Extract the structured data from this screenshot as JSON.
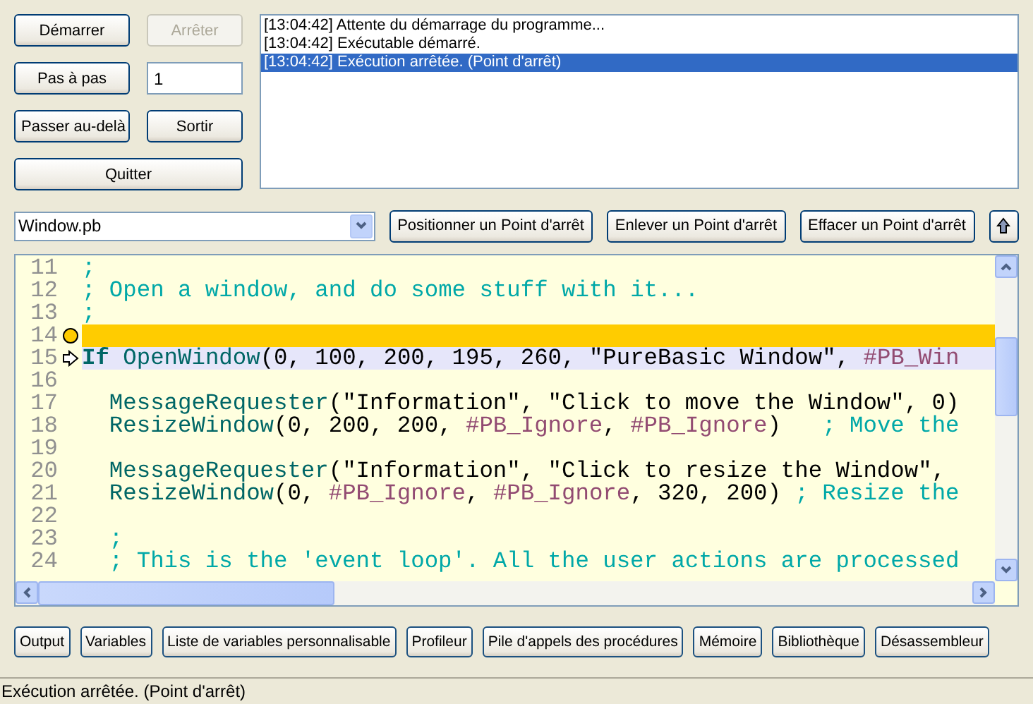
{
  "control_buttons": [
    {
      "label": "Démarrer",
      "disabled": false
    },
    {
      "label": "Arrêter",
      "disabled": true
    },
    {
      "label": "Pas à pas",
      "disabled": false
    },
    {
      "label": "Passer au-delà",
      "disabled": false
    },
    {
      "label": "Sortir",
      "disabled": false
    },
    {
      "label": "Quitter",
      "disabled": false
    }
  ],
  "step_count": {
    "value": "1"
  },
  "log": [
    {
      "text": "[13:04:42] Attente du démarrage du programme...",
      "selected": false
    },
    {
      "text": "[13:04:42] Exécutable démarré.",
      "selected": false
    },
    {
      "text": "[13:04:42] Exécution arrêtée. (Point d'arrêt)",
      "selected": true
    }
  ],
  "file_select": {
    "value": "Window.pb"
  },
  "breakpoint_buttons": [
    "Positionner un Point d'arrêt",
    "Enlever un Point d'arrêt",
    "Effacer un Point d'arrêt"
  ],
  "editor": {
    "lines": [
      {
        "number": "11",
        "tokens": [
          {
            "kind": "comment",
            "text": ";"
          }
        ]
      },
      {
        "number": "12",
        "tokens": [
          {
            "kind": "comment",
            "text": "; Open a window, and do some stuff with it..."
          }
        ]
      },
      {
        "number": "13",
        "tokens": [
          {
            "kind": "comment",
            "text": ";"
          }
        ]
      },
      {
        "number": "14",
        "breakpoint": true
      },
      {
        "number": "15",
        "current": true,
        "tokens": [
          {
            "kind": "keyword",
            "text": "If "
          },
          {
            "kind": "function",
            "text": "OpenWindow"
          },
          {
            "kind": "plain",
            "text": "(0, 100, 200, 195, 260, \"PureBasic Window\", "
          },
          {
            "kind": "constant",
            "text": "#PB_Win"
          }
        ]
      },
      {
        "number": "16"
      },
      {
        "number": "17",
        "indented": true,
        "tokens": [
          {
            "kind": "function",
            "text": "MessageRequester"
          },
          {
            "kind": "plain",
            "text": "(\"Information\", \"Click to move the Window\", 0)"
          }
        ]
      },
      {
        "number": "18",
        "indented": true,
        "tokens": [
          {
            "kind": "function",
            "text": "ResizeWindow"
          },
          {
            "kind": "plain",
            "text": "(0, 200, 200, "
          },
          {
            "kind": "constant",
            "text": "#PB_Ignore"
          },
          {
            "kind": "plain",
            "text": ", "
          },
          {
            "kind": "constant",
            "text": "#PB_Ignore"
          },
          {
            "kind": "plain",
            "text": ")   "
          },
          {
            "kind": "comment",
            "text": "; Move the"
          }
        ]
      },
      {
        "number": "19"
      },
      {
        "number": "20",
        "indented": true,
        "tokens": [
          {
            "kind": "function",
            "text": "MessageRequester"
          },
          {
            "kind": "plain",
            "text": "(\"Information\", \"Click to resize the Window\","
          }
        ]
      },
      {
        "number": "21",
        "indented": true,
        "tokens": [
          {
            "kind": "function",
            "text": "ResizeWindow"
          },
          {
            "kind": "plain",
            "text": "(0, "
          },
          {
            "kind": "constant",
            "text": "#PB_Ignore"
          },
          {
            "kind": "plain",
            "text": ", "
          },
          {
            "kind": "constant",
            "text": "#PB_Ignore"
          },
          {
            "kind": "plain",
            "text": ", 320, 200) "
          },
          {
            "kind": "comment",
            "text": "; Resize the"
          }
        ]
      },
      {
        "number": "22"
      },
      {
        "number": "23",
        "indented": true,
        "tokens": [
          {
            "kind": "comment",
            "text": ";"
          }
        ]
      },
      {
        "number": "24",
        "indented": true,
        "tokens": [
          {
            "kind": "comment",
            "text": "; This is the 'event loop'. All the user actions are processed"
          }
        ]
      }
    ]
  },
  "tool_buttons": [
    "Output",
    "Variables",
    "Liste de variables personnalisable",
    "Profileur",
    "Pile d'appels des procédures",
    "Mémoire",
    "Bibliothèque",
    "Désassembleur"
  ],
  "status_bar": "Exécution arrêtée. (Point d'arrêt)"
}
